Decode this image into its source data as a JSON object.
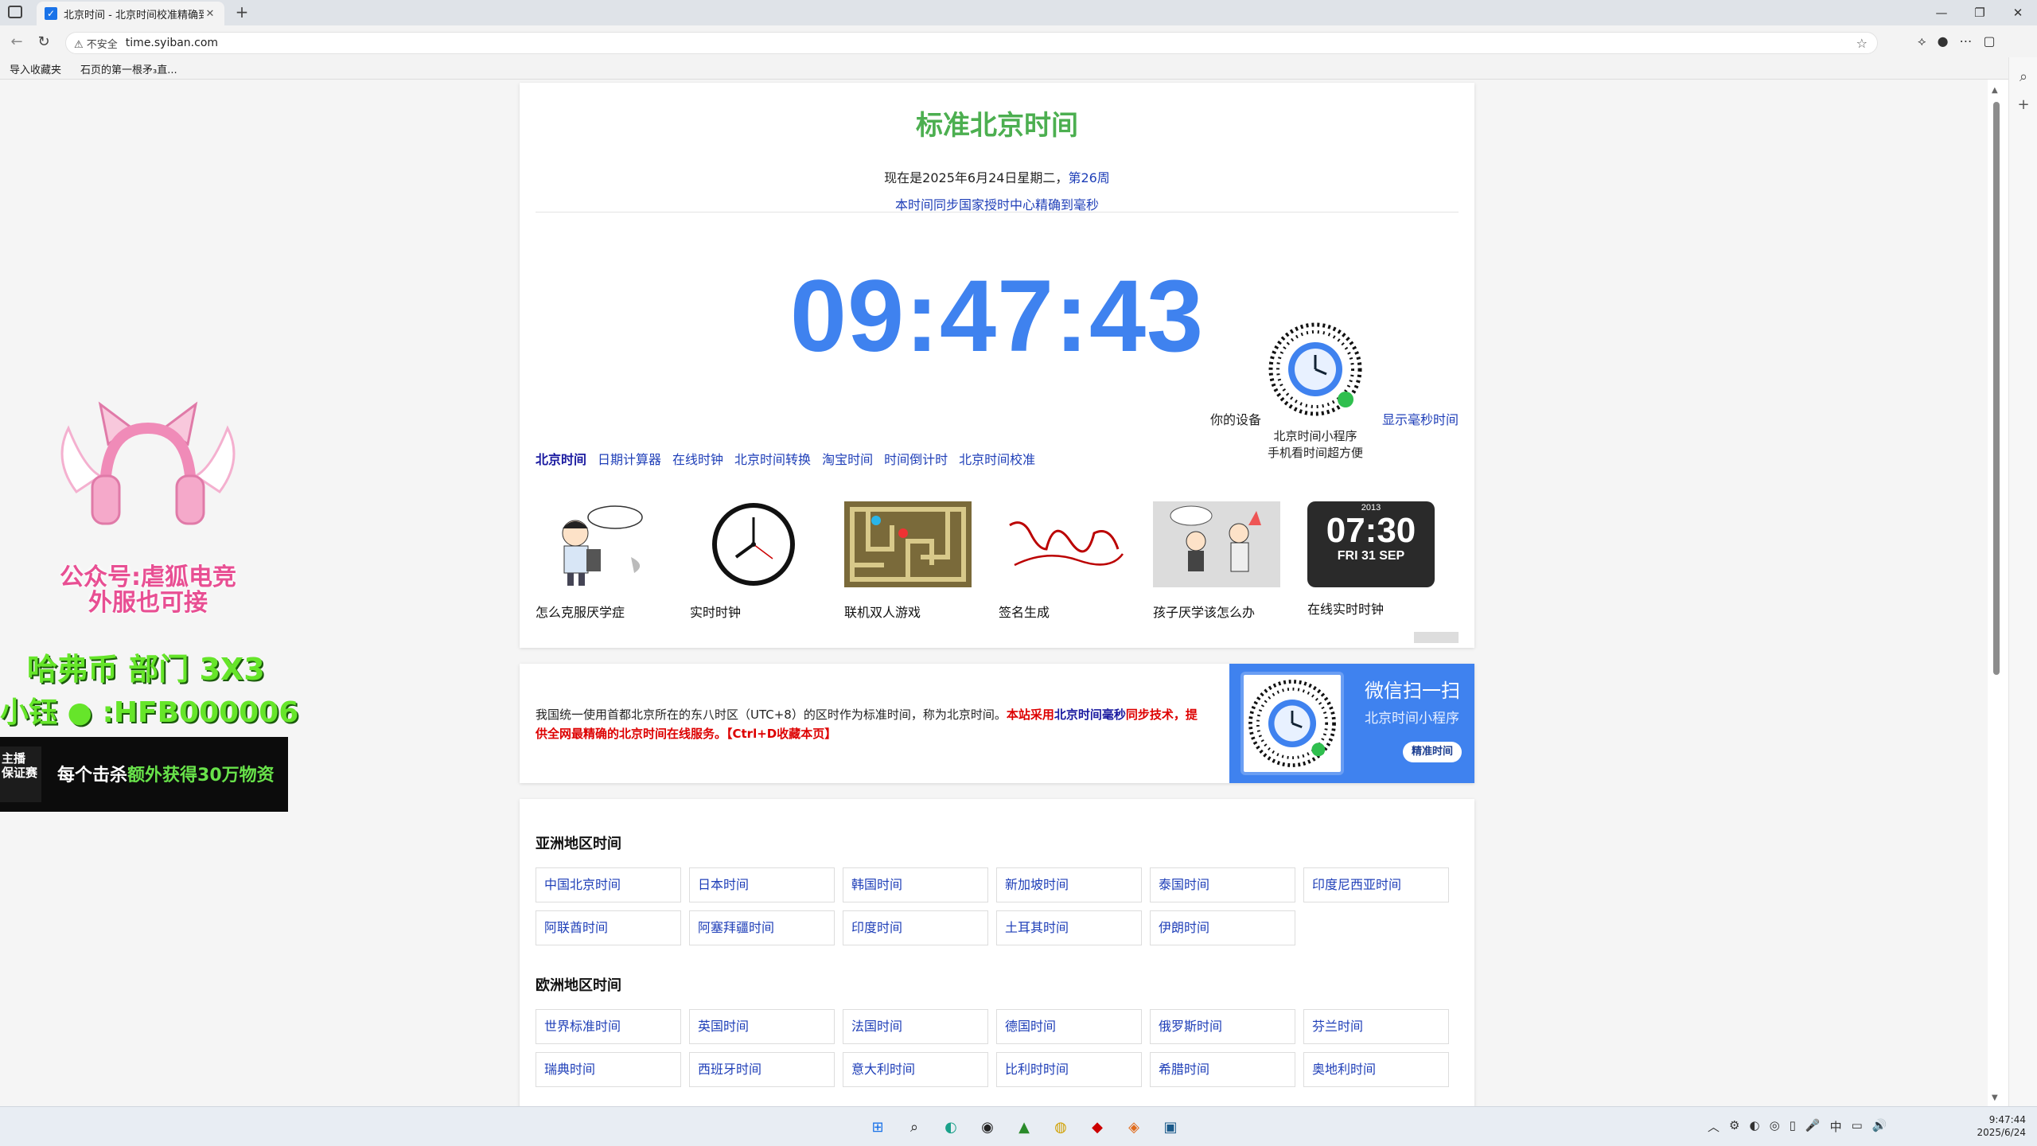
{
  "browser": {
    "tab_title": "北京时间 - 北京时间校准精确到毫",
    "tab_favicon": "✓",
    "close_tab": "✕",
    "new_tab": "+",
    "win_minimize": "—",
    "win_restore": "❐",
    "win_close": "✕",
    "back": "←",
    "reload": "↻",
    "security_label": "⚠ 不安全",
    "url": "time.syiban.com",
    "favorite_star": "☆",
    "bookmarks": [
      "导入收藏夹",
      "石页的第一根矛₃直..."
    ],
    "rail_icons": [
      "⌕",
      "+"
    ],
    "tool_icons": [
      "⟡",
      "●",
      "⋯",
      "▢"
    ]
  },
  "header": {
    "title": "标准北京时间",
    "date_text": "现在是2025年6月24日星期二，",
    "week_text": "第26周",
    "sync_text": "本时间同步国家授时中心精确到毫秒"
  },
  "clock": {
    "time": "09:47:43",
    "device_label": "你的设备",
    "ms_link": "显示毫秒时间",
    "mini_program_line1": "北京时间小程序",
    "mini_program_line2": "手机看时间超方便"
  },
  "nav": {
    "links": [
      "北京时间",
      "日期计算器",
      "在线时钟",
      "北京时间转换",
      "淘宝时间",
      "时间倒计时",
      "北京时间校准"
    ]
  },
  "thumbs": {
    "captions": [
      "怎么克服厌学症",
      "实时时钟",
      "联机双人游戏",
      "签名生成",
      "孩子厌学该怎么办",
      "在线实时时钟"
    ],
    "flip_year": "2013",
    "flip_time": "07:30",
    "flip_date": "FRI 31 SEP"
  },
  "info": {
    "plain": "我国统一使用首都北京所在的东八时区（UTC+8）的区时作为标准时间，称为北京时间。",
    "red1": "本站采用",
    "blue": "北京时间毫秒",
    "red2": "同步技术，提供全网最精确的北京时间在线服务。【Ctrl+D收藏本页】"
  },
  "scan": {
    "title": "微信扫一扫",
    "subtitle": "北京时间小程序",
    "button": "精准时间"
  },
  "regions": {
    "asia_title": "亚洲地区时间",
    "asia": [
      "中国北京时间",
      "日本时间",
      "韩国时间",
      "新加坡时间",
      "泰国时间",
      "印度尼西亚时间",
      "阿联酋时间",
      "阿塞拜疆时间",
      "印度时间",
      "土耳其时间",
      "伊朗时间"
    ],
    "europe_title": "欧洲地区时间",
    "europe": [
      "世界标准时间",
      "英国时间",
      "法国时间",
      "德国时间",
      "俄罗斯时间",
      "芬兰时间",
      "瑞典时间",
      "西班牙时间",
      "意大利时间",
      "比利时时间",
      "希腊时间",
      "奥地利时间"
    ]
  },
  "ad": {
    "cat_text1": "公众号:虐狐电竞",
    "cat_text2": "外服也可接",
    "line1": "哈弗币 部门 3X3",
    "line2": "小钰 ● :HFB000006",
    "badge": "主播 保证赛",
    "dark_text_a": "每个击杀",
    "dark_text_b": "额外获得30万物资"
  },
  "taskbar": {
    "icons": [
      "⊞",
      "⌕",
      "◐",
      "◉",
      "▲",
      "◍",
      "◆",
      "◈",
      "▣"
    ],
    "tray": [
      "︿",
      "⚙",
      "◐",
      "◎",
      "▯",
      "🎤",
      "中",
      "▭",
      "🔊"
    ],
    "time": "9:47:44",
    "date": "2025/6/24"
  },
  "colors": {
    "accent_blue": "#3f82ef",
    "title_green": "#4caf50",
    "link_blue": "#1f3fb8"
  }
}
